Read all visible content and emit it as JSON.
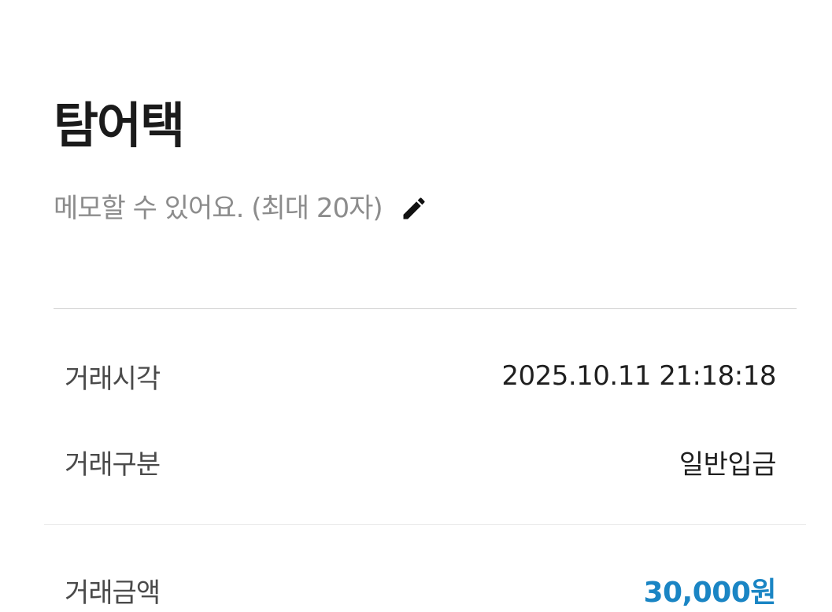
{
  "header": {
    "title": "탐어택",
    "memo_placeholder": "메모할 수 있어요. (최대 20자)",
    "memo_edit_icon": "pencil-icon"
  },
  "details": {
    "time": {
      "label": "거래시각",
      "value": "2025.10.11 21:18:18"
    },
    "type": {
      "label": "거래구분",
      "value": "일반입금"
    },
    "amount": {
      "label": "거래금액",
      "value": "30,000원"
    }
  },
  "colors": {
    "amount_accent": "#1a85c4",
    "memo_text": "#8c8c8c",
    "divider": "#cfcfcf"
  }
}
